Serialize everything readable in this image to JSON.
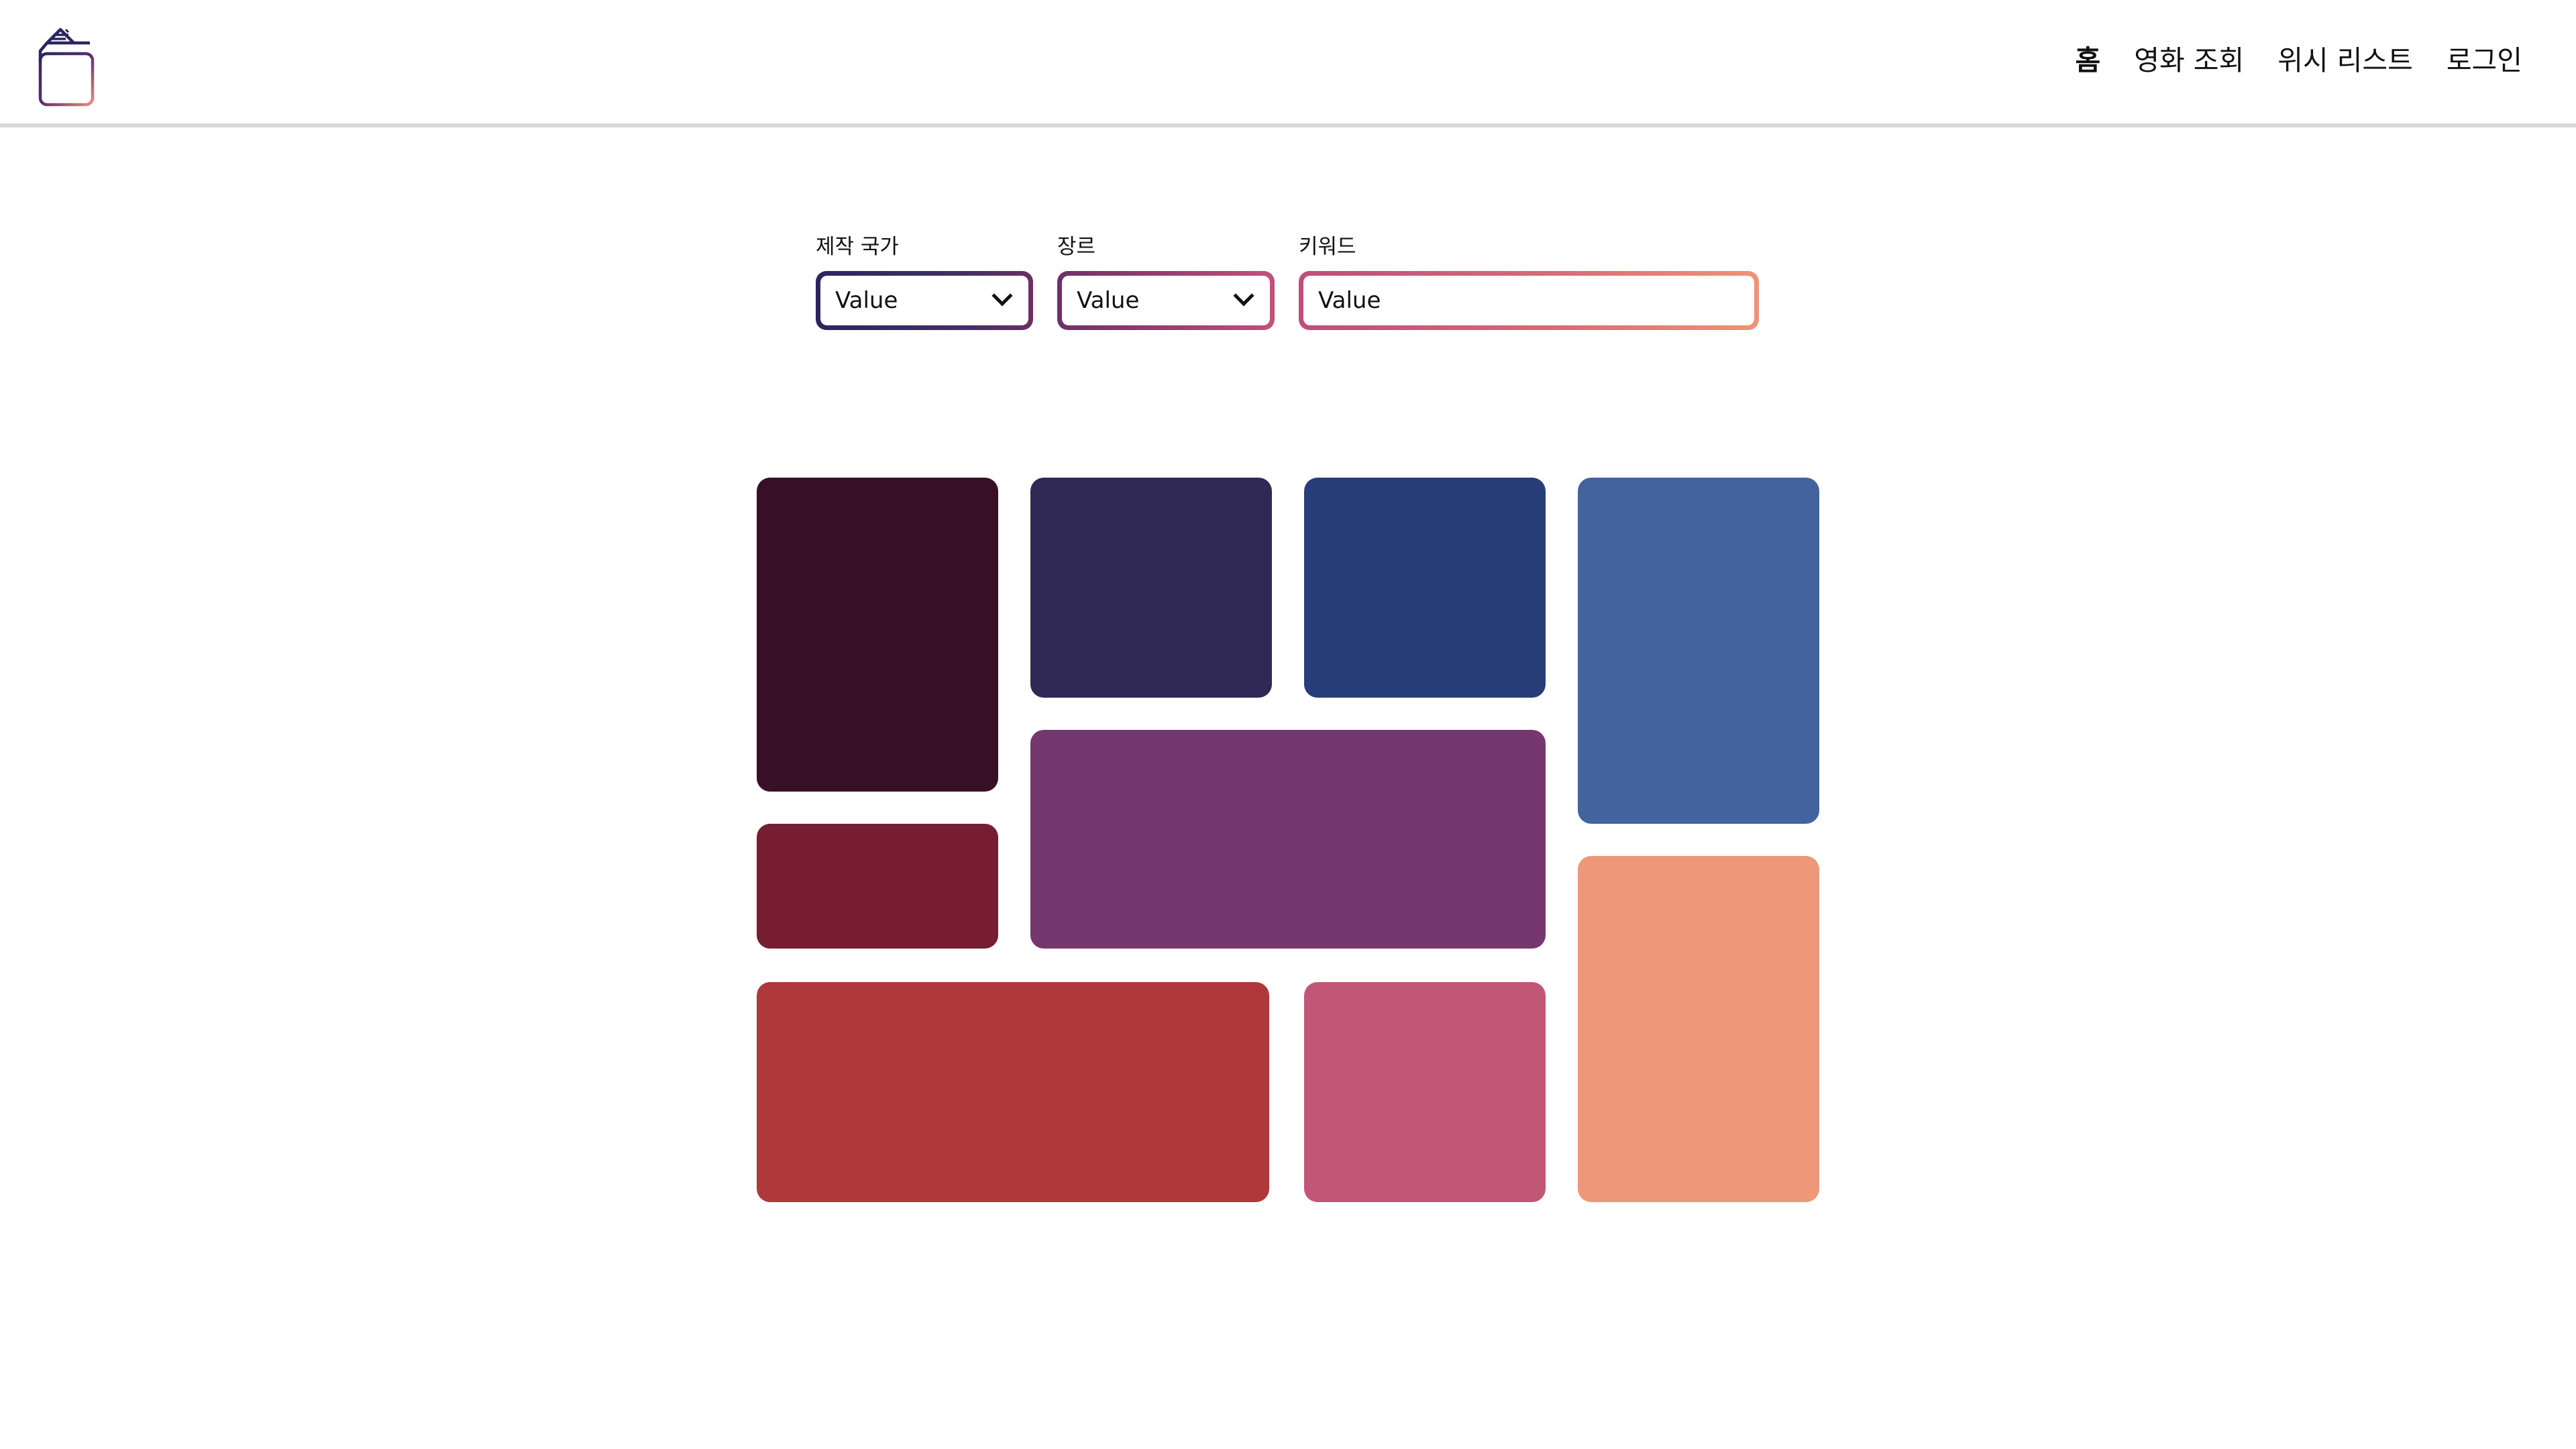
{
  "nav": {
    "items": [
      {
        "label": "홈",
        "active": true
      },
      {
        "label": "영화 조회",
        "active": false
      },
      {
        "label": "위시 리스트",
        "active": false
      },
      {
        "label": "로그인",
        "active": false
      }
    ]
  },
  "filters": {
    "country": {
      "label": "제작 국가",
      "value": "Value"
    },
    "genre": {
      "label": "장르",
      "value": "Value"
    },
    "keyword": {
      "label": "키워드",
      "value": "Value"
    }
  },
  "tiles": [
    {
      "color": "#371028"
    },
    {
      "color": "#302855"
    },
    {
      "color": "#283e79"
    },
    {
      "color": "#42639e"
    },
    {
      "color": "#761d31"
    },
    {
      "color": "#75376d"
    },
    {
      "color": "#b0373a"
    },
    {
      "color": "#c15776"
    },
    {
      "color": "#ed9878"
    }
  ]
}
